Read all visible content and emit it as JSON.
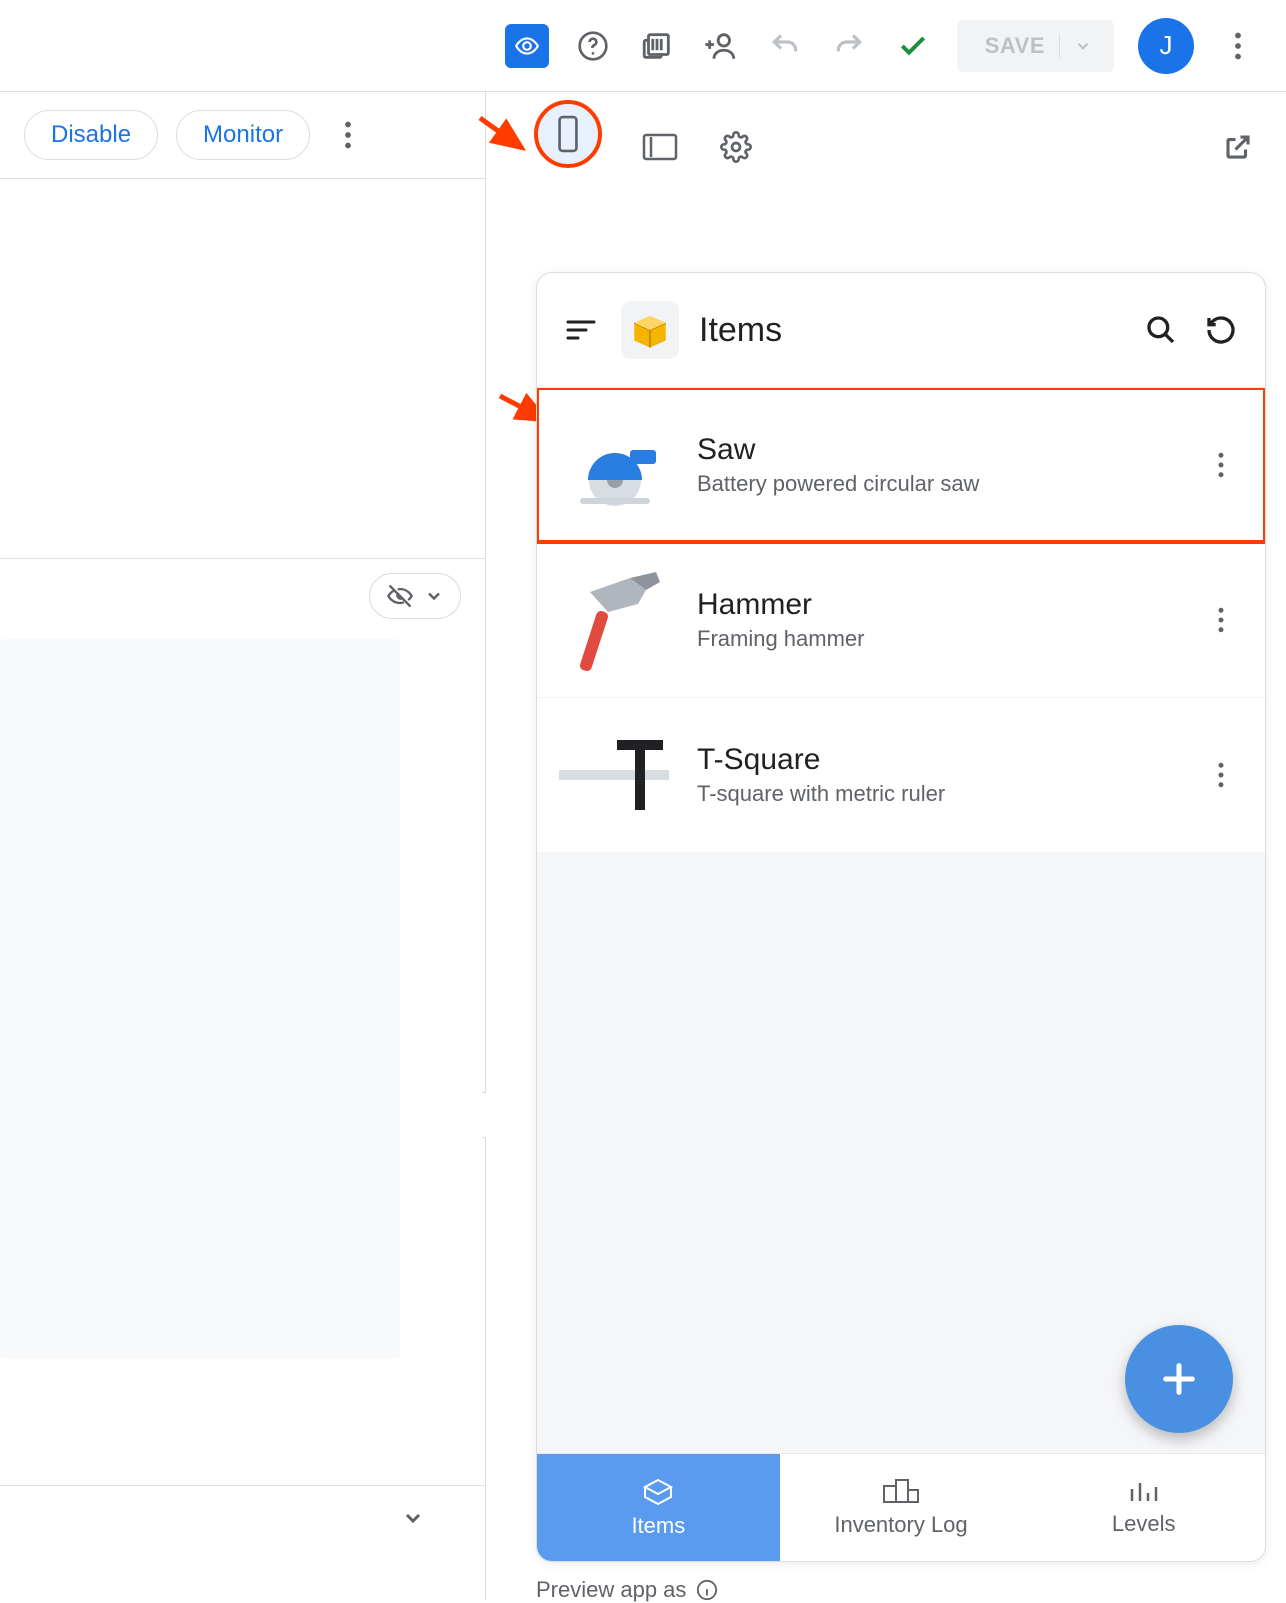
{
  "toolbar": {
    "save_label": "SAVE",
    "avatar_letter": "J"
  },
  "left": {
    "disable_label": "Disable",
    "monitor_label": "Monitor"
  },
  "preview": {
    "app_title": "Items",
    "items": [
      {
        "title": "Saw",
        "subtitle": "Battery powered circular saw"
      },
      {
        "title": "Hammer",
        "subtitle": "Framing hammer"
      },
      {
        "title": "T-Square",
        "subtitle": "T-square with metric ruler"
      }
    ],
    "tabs": [
      {
        "label": "Items"
      },
      {
        "label": "Inventory Log"
      },
      {
        "label": "Levels"
      }
    ],
    "preview_as_label": "Preview app as"
  }
}
